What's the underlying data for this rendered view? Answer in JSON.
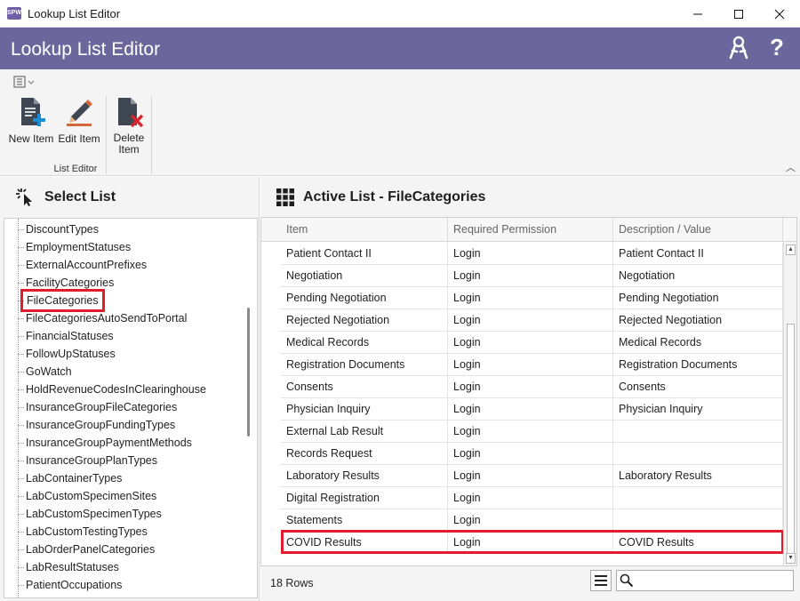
{
  "window": {
    "title": "Lookup List Editor",
    "app_badge": "SPW"
  },
  "header": {
    "title": "Lookup List Editor",
    "help_label": "?"
  },
  "ribbon": {
    "buttons": [
      {
        "label": "New Item",
        "icon": "new-document-icon"
      },
      {
        "label": "Edit Item",
        "icon": "edit-pencil-icon"
      },
      {
        "label": "Delete Item",
        "icon": "delete-document-icon"
      }
    ],
    "group_label": "List Editor",
    "collapse_glyph": "︿"
  },
  "select_list": {
    "title": "Select List",
    "items": [
      "DiscountTypes",
      "EmploymentStatuses",
      "ExternalAccountPrefixes",
      "FacilityCategories",
      "FileCategories",
      "FileCategoriesAutoSendToPortal",
      "FinancialStatuses",
      "FollowUpStatuses",
      "GoWatch",
      "HoldRevenueCodesInClearinghouse",
      "InsuranceGroupFileCategories",
      "InsuranceGroupFundingTypes",
      "InsuranceGroupPaymentMethods",
      "InsuranceGroupPlanTypes",
      "LabContainerTypes",
      "LabCustomSpecimenSites",
      "LabCustomSpecimenTypes",
      "LabCustomTestingTypes",
      "LabOrderPanelCategories",
      "LabResultStatuses",
      "PatientOccupations"
    ],
    "selected": "FileCategories"
  },
  "active_list": {
    "title": "Active List - FileCategories",
    "columns": [
      "Item",
      "Required Permission",
      "Description / Value"
    ],
    "rows": [
      [
        "Patient Contact II",
        "Login",
        "Patient Contact II"
      ],
      [
        "Negotiation",
        "Login",
        "Negotiation"
      ],
      [
        "Pending Negotiation",
        "Login",
        "Pending Negotiation"
      ],
      [
        "Rejected Negotiation",
        "Login",
        "Rejected Negotiation"
      ],
      [
        "Medical Records",
        "Login",
        "Medical Records"
      ],
      [
        "Registration Documents",
        "Login",
        "Registration Documents"
      ],
      [
        "Consents",
        "Login",
        "Consents"
      ],
      [
        "Physician Inquiry",
        "Login",
        "Physician Inquiry"
      ],
      [
        "External Lab Result",
        "Login",
        ""
      ],
      [
        "Records Request",
        "Login",
        ""
      ],
      [
        "Laboratory Results",
        "Login",
        "Laboratory Results"
      ],
      [
        "Digital Registration",
        "Login",
        ""
      ],
      [
        "Statements",
        "Login",
        ""
      ],
      [
        "COVID Results",
        "Login",
        "COVID Results"
      ]
    ],
    "highlighted_row": "COVID Results",
    "row_count": "18 Rows",
    "search_value": ""
  },
  "colors": {
    "header_bg": "#6b679c",
    "highlight": "#e01e2b",
    "ribbon_bg": "#f4f4f4"
  }
}
